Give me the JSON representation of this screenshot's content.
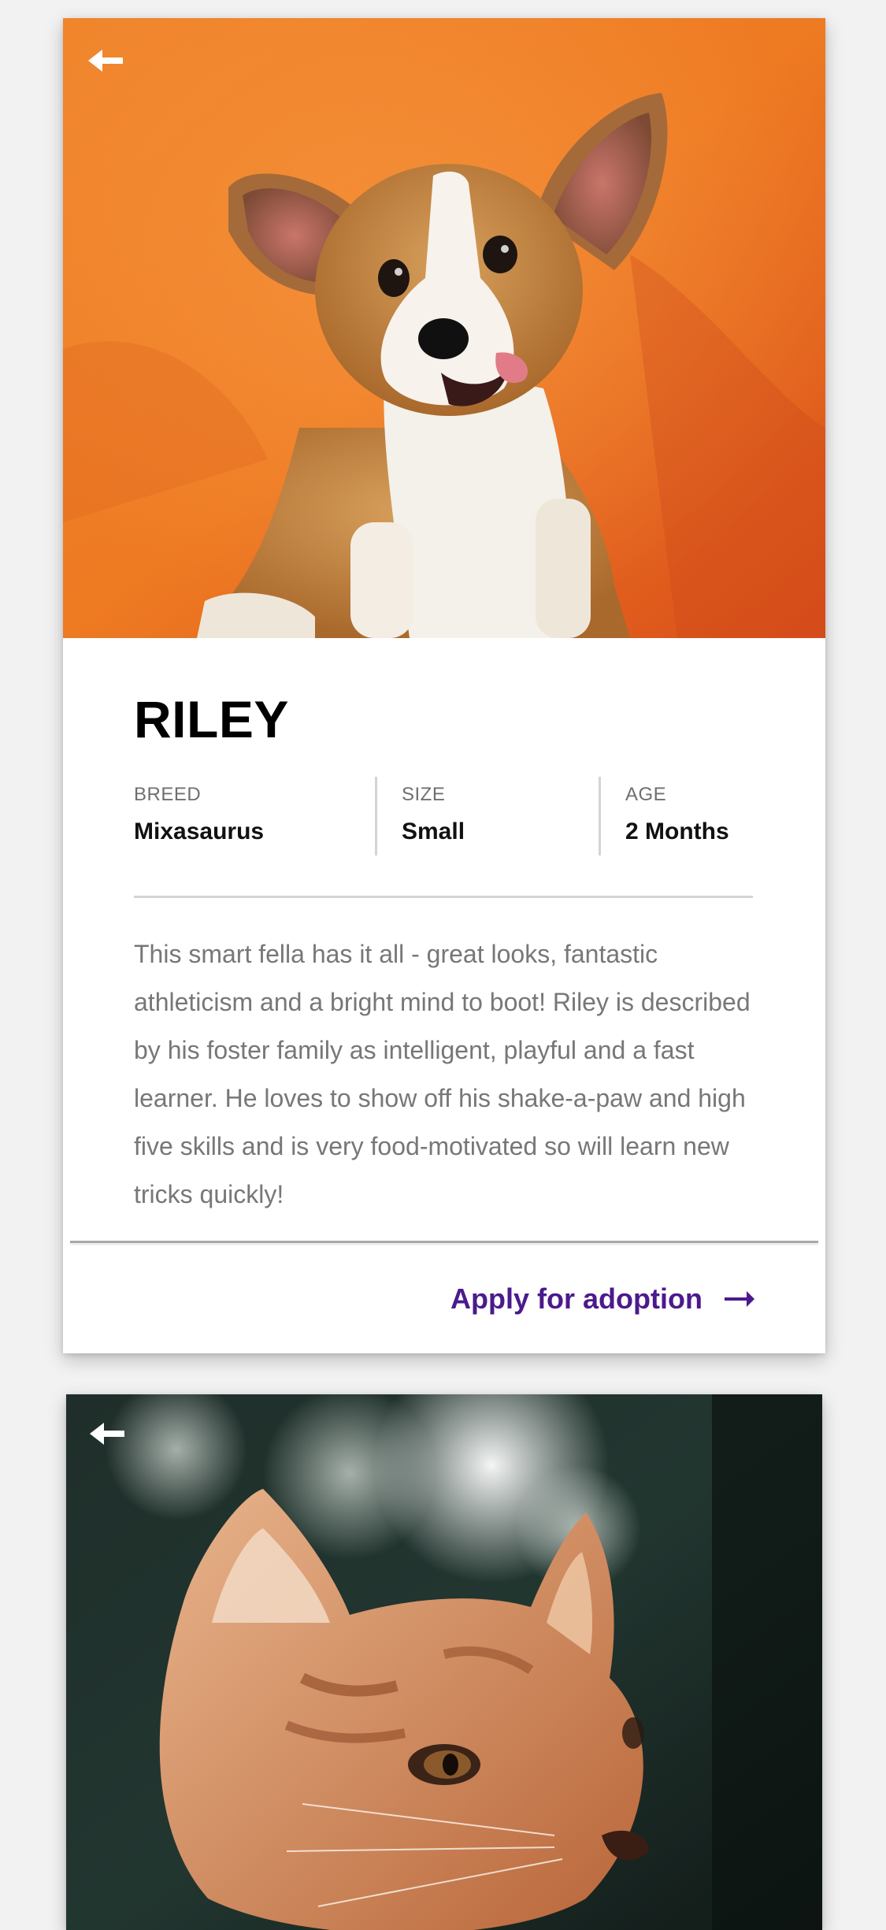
{
  "pets": [
    {
      "name": "RILEY",
      "stats": [
        {
          "label": "BREED",
          "value": "Mixasaurus"
        },
        {
          "label": "SIZE",
          "value": "Small"
        },
        {
          "label": "AGE",
          "value": "2 Months"
        }
      ],
      "description": "This smart fella has it all - great looks, fantastic athleticism and a bright mind to boot! Riley is described by his foster family as intelligent, playful and a fast learner. He loves to show off his shake-a-paw and high five skills and is very food-motivated so will learn new tricks quickly!",
      "apply_label": "Apply for adoption",
      "photo_subject": "corgi puppy on orange backdrop"
    },
    {
      "photo_subject": "orange tabby kitten in foliage"
    }
  ],
  "icons": {
    "back": "arrow-left-icon",
    "apply": "arrow-right-icon"
  },
  "colors": {
    "accent": "#4b1a8c",
    "title": "#000000",
    "body_text": "#777777",
    "label_text": "#6f6f6f",
    "divider": "#d4d4d4",
    "background": "#f2f2f2"
  }
}
